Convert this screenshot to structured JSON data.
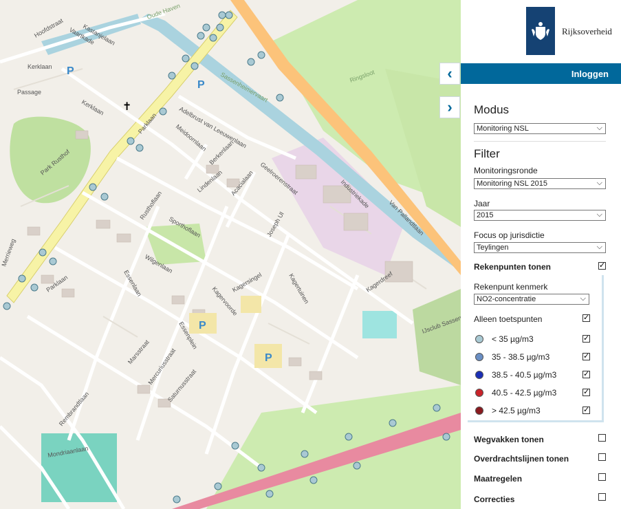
{
  "header": {
    "brand": "Rijksoverheid",
    "login_label": "Inloggen",
    "collapse_glyph": "‹",
    "expand_glyph": "›"
  },
  "panel": {
    "modus_title": "Modus",
    "modus_value": "Monitoring NSL",
    "filter_title": "Filter",
    "ronde_label": "Monitoringsronde",
    "ronde_value": "Monitoring NSL 2015",
    "jaar_label": "Jaar",
    "jaar_value": "2015",
    "focus_label": "Focus op jurisdictie",
    "focus_value": "Teylingen",
    "rekenpunten_label": "Rekenpunten tonen",
    "kenmerk_label": "Rekenpunt kenmerk",
    "kenmerk_value": "NO2-concentratie",
    "toetspunten_label": "Alleen toetspunten",
    "legend": [
      {
        "label": "< 35 µg/m3",
        "color": "#a9c9d3",
        "checked": true
      },
      {
        "label": "35 - 38.5 µg/m3",
        "color": "#6a8fc4",
        "checked": true
      },
      {
        "label": "38.5 - 40.5 µg/m3",
        "color": "#1b2fb5",
        "checked": true
      },
      {
        "label": "40.5 - 42.5 µg/m3",
        "color": "#c9232a",
        "checked": true
      },
      {
        "label": "> 42.5 µg/m3",
        "color": "#8a1a1f",
        "checked": true
      }
    ],
    "wegvakken_label": "Wegvakken tonen",
    "overdracht_label": "Overdrachtslijnen tonen",
    "maatregelen_label": "Maatregelen",
    "correcties_label": "Correcties"
  },
  "map": {
    "streets": [
      "Parklaan",
      "Kerklaan",
      "Hoofdstraat",
      "Kastanjelaan",
      "Vaartkade",
      "Passage",
      "Park Rusthof",
      "Adelbrust van Leeuwenlaan",
      "Meidoornlaan",
      "Berkenlaan",
      "Lindenlaan",
      "Acacialaan",
      "Rusthoflaan",
      "Sporthoflaan",
      "Wilgenlaan",
      "Essenlaan",
      "Kagervoorde",
      "Kagersingel",
      "Kagertuinen",
      "Kagerdreef",
      "Essenplein",
      "Marsstraat",
      "Mercuriusstraat",
      "Saturnusstraat",
      "Merrieweg",
      "Rembrandtlaan",
      "Mondriaanlaan",
      "Industriekade",
      "Van Pallandtlaan",
      "Ringsloot",
      "Oude Haven",
      "Sassenheimervaart",
      "Joseph Ul",
      "Geelroerenstraat"
    ],
    "poi_labels": [
      "P",
      "P",
      "P",
      "P"
    ],
    "club_label": "IJsclub Sassenheim"
  }
}
